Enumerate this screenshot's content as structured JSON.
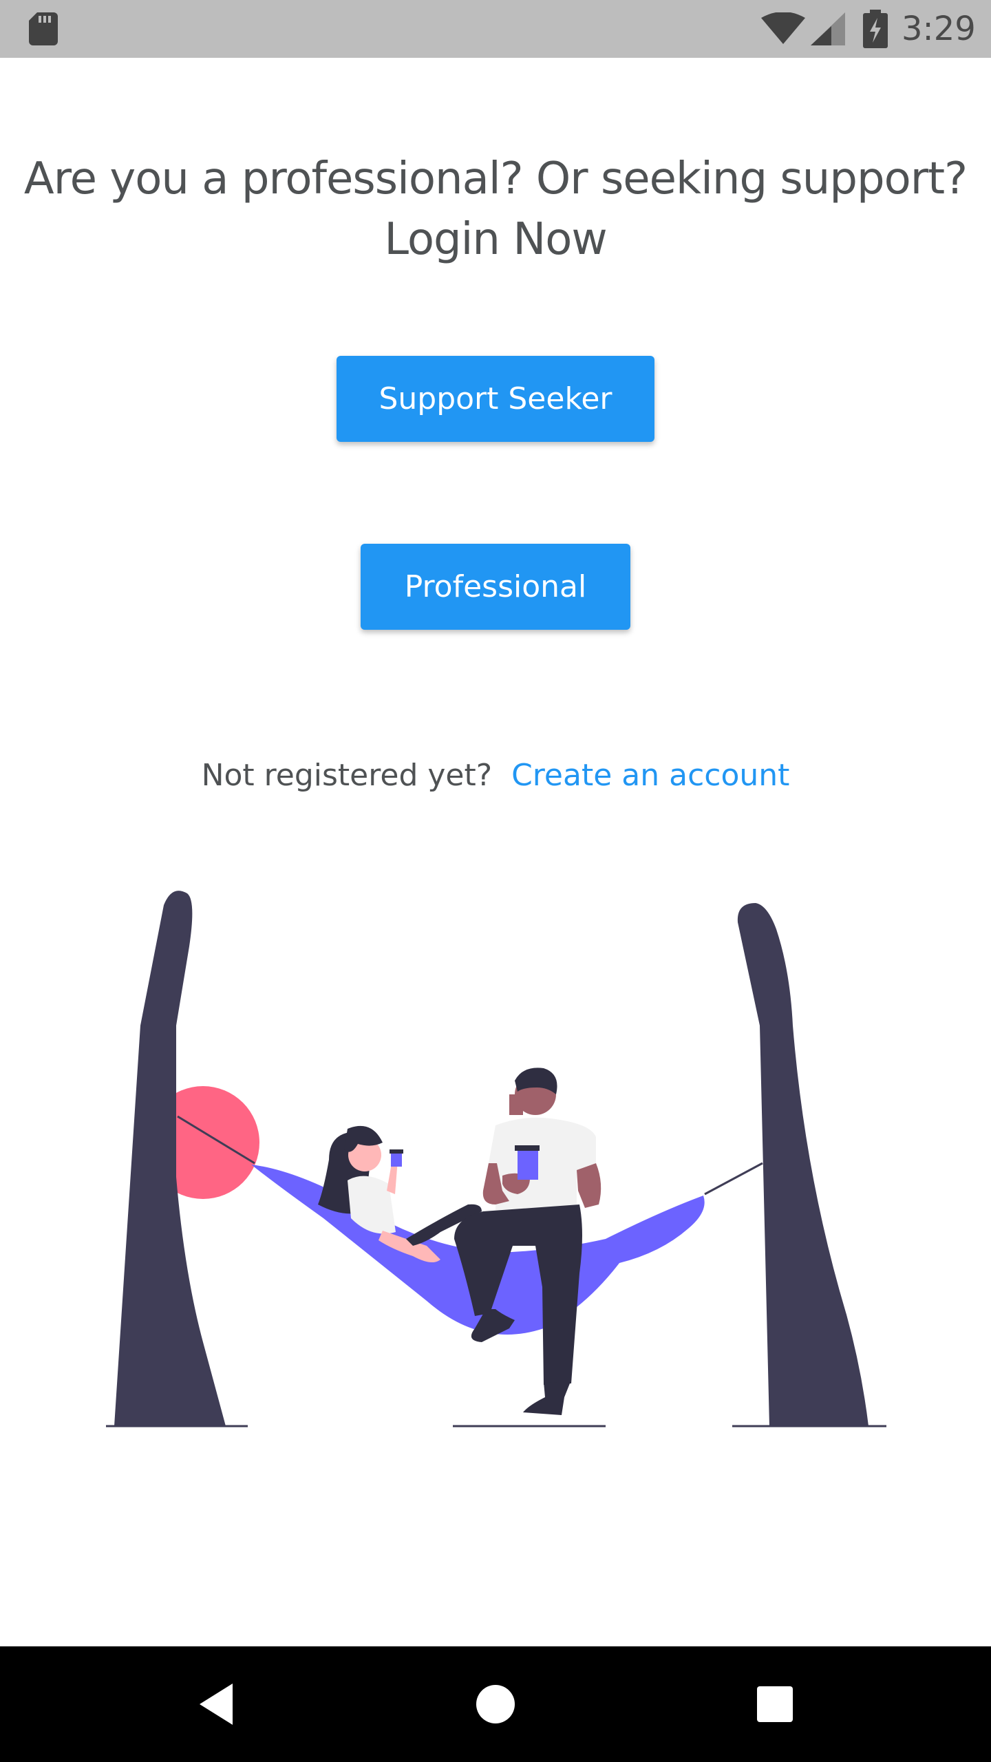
{
  "status_bar": {
    "time": "3:29",
    "icons": [
      "sd-card-icon",
      "wifi-icon",
      "cell-signal-icon",
      "battery-charging-icon"
    ]
  },
  "heading": {
    "line1": "Are you a professional? Or seeking support?",
    "line2": "Login Now"
  },
  "buttons": {
    "support_seeker_label": "Support Seeker",
    "professional_label": "Professional"
  },
  "register": {
    "prompt": "Not registered yet?",
    "link_label": "Create an account"
  },
  "colors": {
    "primary": "#2196f3",
    "heading_text": "#4f5254",
    "status_bar_bg": "#bdbdbd",
    "nav_bar_bg": "#000000",
    "tree": "#3f3d56",
    "hammock": "#6c63ff",
    "sun": "#ff6584"
  },
  "illustration": {
    "icon": "hammock-illustration"
  },
  "nav_bar": {
    "icons": [
      "back-icon",
      "home-icon",
      "recents-icon"
    ]
  }
}
